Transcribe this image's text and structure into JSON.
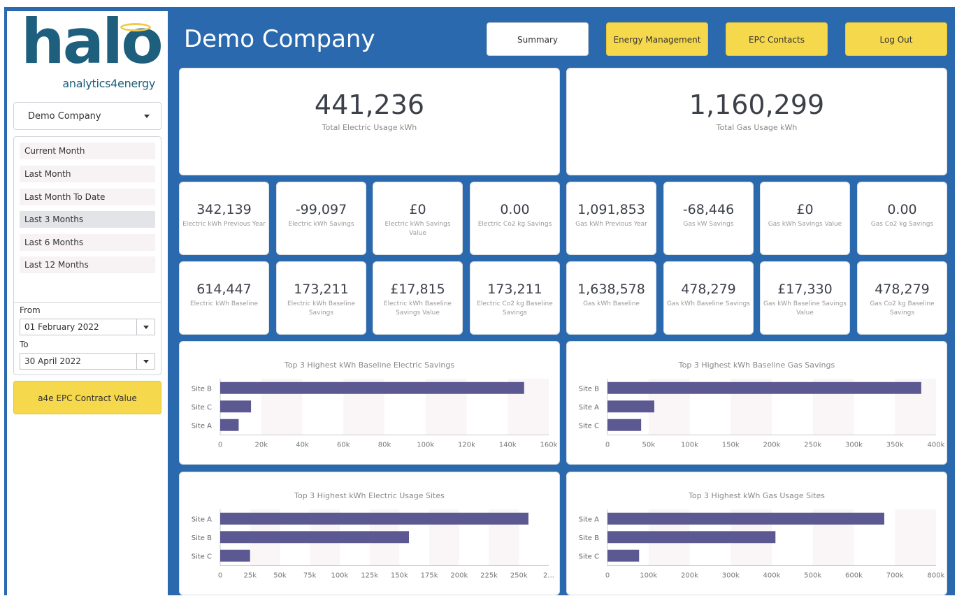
{
  "sidebar": {
    "logo_word": "halo",
    "logo_sub": "analytics4energy",
    "company_select": "Demo Company",
    "periods": [
      "Current Month",
      "Last Month",
      "Last Month To Date",
      "Last 3 Months",
      "Last 6 Months",
      "Last 12 Months"
    ],
    "selected_period": "Last 3 Months",
    "from_label": "From",
    "from_value": "01 February 2022",
    "to_label": "To",
    "to_value": "30 April 2022",
    "epc_button": "a4e EPC Contract Value"
  },
  "header": {
    "title": "Demo Company",
    "nav": [
      "Summary",
      "Energy Management",
      "EPC Contacts",
      "Log Out"
    ]
  },
  "totals": [
    {
      "value": "441,236",
      "label": "Total Electric Usage kWh"
    },
    {
      "value": "1,160,299",
      "label": "Total Gas Usage kWh"
    }
  ],
  "kpi_row1": [
    {
      "value": "342,139",
      "label": "Electric kWh Previous Year"
    },
    {
      "value": "-99,097",
      "label": "Electric kWh Savings"
    },
    {
      "value": "£0",
      "label": "Electric kWh Savings Value"
    },
    {
      "value": "0.00",
      "label": "Electric Co2 kg Savings"
    },
    {
      "value": "1,091,853",
      "label": "Gas kWh Previous Year"
    },
    {
      "value": "-68,446",
      "label": "Gas kW Savings"
    },
    {
      "value": "£0",
      "label": "Gas kWh Savings Value"
    },
    {
      "value": "0.00",
      "label": "Gas Co2 kg Savings"
    }
  ],
  "kpi_row2": [
    {
      "value": "614,447",
      "label": "Electric kWh Baseline"
    },
    {
      "value": "173,211",
      "label": "Electric kWh Baseline Savings"
    },
    {
      "value": "£17,815",
      "label": "Electric kWh Baseline Savings Value"
    },
    {
      "value": "173,211",
      "label": "Electric Co2 kg Baseline Savings"
    },
    {
      "value": "1,638,578",
      "label": "Gas kWh Baseline"
    },
    {
      "value": "478,279",
      "label": "Gas kWh Baseline Savings"
    },
    {
      "value": "£17,330",
      "label": "Gas kWh Baseline Savings Value"
    },
    {
      "value": "478,279",
      "label": "Gas Co2 kg Baseline Savings"
    }
  ],
  "chart_data": [
    {
      "type": "bar",
      "orientation": "horizontal",
      "title": "Top 3 Highest kWh Baseline Electric Savings",
      "categories": [
        "Site B",
        "Site C",
        "Site A"
      ],
      "values": [
        148000,
        15000,
        9000
      ],
      "xlim": [
        0,
        160000
      ],
      "ticks": [
        "0",
        "20k",
        "40k",
        "60k",
        "80k",
        "100k",
        "120k",
        "140k",
        "160k"
      ],
      "color": "#5c5891"
    },
    {
      "type": "bar",
      "orientation": "horizontal",
      "title": "Top 3 Highest kWh Baseline Gas Savings",
      "categories": [
        "Site B",
        "Site A",
        "Site C"
      ],
      "values": [
        382000,
        57000,
        41000
      ],
      "xlim": [
        0,
        400000
      ],
      "ticks": [
        "0",
        "50k",
        "100k",
        "150k",
        "200k",
        "250k",
        "300k",
        "350k",
        "400k"
      ],
      "color": "#5c5891"
    },
    {
      "type": "bar",
      "orientation": "horizontal",
      "title": "Top 3 Highest kWh Electric Usage Sites",
      "categories": [
        "Site A",
        "Site B",
        "Site C"
      ],
      "values": [
        258000,
        158000,
        25000
      ],
      "xlim": [
        0,
        275000
      ],
      "ticks": [
        "0",
        "25k",
        "50k",
        "75k",
        "100k",
        "125k",
        "150k",
        "175k",
        "200k",
        "225k",
        "250k",
        "2..."
      ],
      "color": "#5c5891"
    },
    {
      "type": "bar",
      "orientation": "horizontal",
      "title": "Top 3 Highest kWh Gas Usage Sites",
      "categories": [
        "Site A",
        "Site B",
        "Site C"
      ],
      "values": [
        674000,
        409000,
        77000
      ],
      "xlim": [
        0,
        800000
      ],
      "ticks": [
        "0",
        "100k",
        "200k",
        "300k",
        "400k",
        "500k",
        "600k",
        "700k",
        "800k"
      ],
      "color": "#5c5891"
    }
  ]
}
